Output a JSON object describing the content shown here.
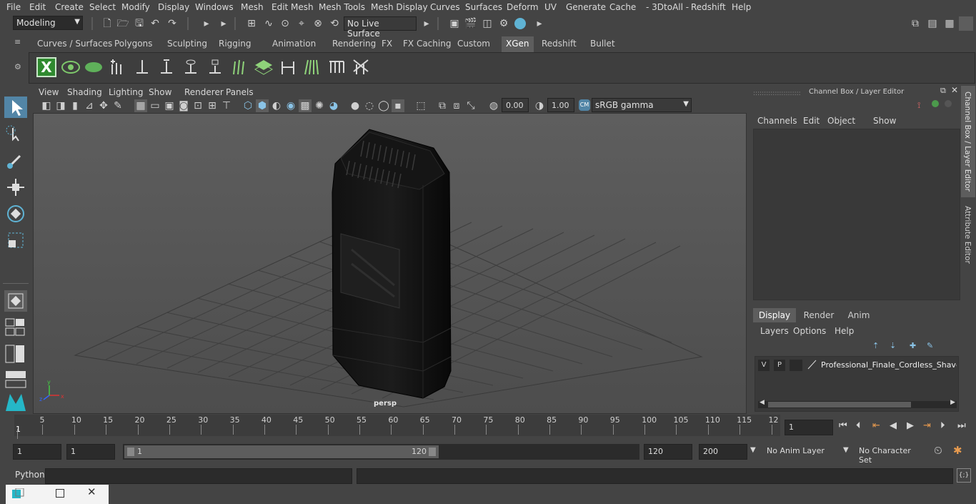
{
  "menubar": [
    "File",
    "Edit",
    "Create",
    "Select",
    "Modify",
    "Display",
    "Windows",
    "Mesh",
    "Edit Mesh",
    "Mesh Tools",
    "Mesh Display",
    "Curves",
    "Surfaces",
    "Deform",
    "UV",
    "Generate",
    "Cache",
    "- 3DtoAll -",
    "Redshift",
    "Help"
  ],
  "status": {
    "mode": "Modeling",
    "live_surface": "No Live Surface"
  },
  "shelf_tabs": [
    "Curves / Surfaces",
    "Polygons",
    "Sculpting",
    "Rigging",
    "Animation",
    "Rendering",
    "FX",
    "FX Caching",
    "Custom",
    "XGen",
    "Redshift",
    "Bullet"
  ],
  "shelf_active": "XGen",
  "panel_menu": [
    "View",
    "Shading",
    "Lighting",
    "Show",
    "Renderer",
    "Panels"
  ],
  "view_toolbar": {
    "exposure": "0.00",
    "gamma": "1.00",
    "color_space": "sRGB gamma"
  },
  "viewport": {
    "camera_label": "persp"
  },
  "channel_box": {
    "title": "Channel Box / Layer Editor",
    "menus": [
      "Channels",
      "Edit",
      "Object",
      "Show"
    ],
    "tabs": [
      "Display",
      "Render",
      "Anim"
    ],
    "active_tab": "Display",
    "layer_menus": [
      "Layers",
      "Options",
      "Help"
    ],
    "layer": {
      "v": "V",
      "p": "P",
      "name": "Professional_Finale_Cordless_Shaver_"
    }
  },
  "side_tabs": [
    "Channel Box / Layer Editor",
    "Attribute Editor"
  ],
  "timeline": {
    "ticks": [
      "5",
      "10",
      "15",
      "20",
      "25",
      "30",
      "35",
      "40",
      "45",
      "50",
      "55",
      "60",
      "65",
      "70",
      "75",
      "80",
      "85",
      "90",
      "95",
      "100",
      "105",
      "110",
      "115",
      "12"
    ],
    "current_marker": "1",
    "current_frame": "1"
  },
  "range": {
    "start": "1",
    "start2": "1",
    "slider_start": "1",
    "slider_end": "120",
    "end": "120",
    "end2": "200",
    "anim_layer": "No Anim Layer",
    "char_set": "No Character Set"
  },
  "cmd": {
    "label": "Python"
  },
  "colors": {
    "accent": "#5285a6",
    "bg": "#444444",
    "viewport": "#5b5b5b",
    "field": "#2b2b2b"
  }
}
